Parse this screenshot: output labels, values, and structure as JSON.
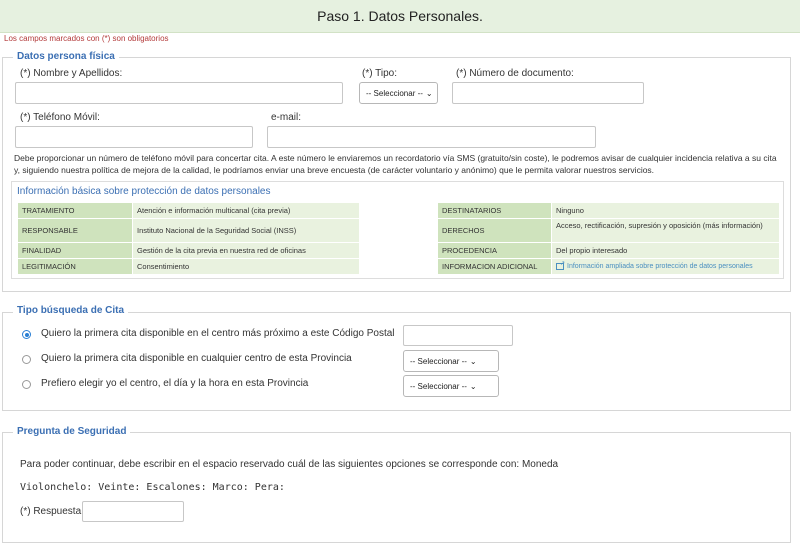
{
  "header": {
    "title": "Paso 1. Datos Personales."
  },
  "required_note": "Los campos marcados con (*) son obligatorios",
  "personal": {
    "legend": "Datos persona física",
    "name_label": "(*) Nombre y Apellidos:",
    "type_label": "(*) Tipo:",
    "type_value": "-- Seleccionar --",
    "doc_label": "(*) Número de documento:",
    "phone_label": "(*) Teléfono Móvil:",
    "email_label": "e-mail:",
    "info_text": "Debe proporcionar un número de teléfono móvil para concertar cita. A este número le enviaremos un recordatorio vía SMS (gratuito/sin coste), le podremos avisar de cualquier incidencia relativa a su cita y, siguiendo nuestra política de mejora de la calidad, le podríamos enviar una breve encuesta (de carácter voluntario y anónimo) que le permita valorar nuestros servicios."
  },
  "data_protection": {
    "title": "Información básica sobre protección de datos personales",
    "left": [
      {
        "key": "TRATAMIENTO",
        "value": "Atención e información multicanal (cita previa)"
      },
      {
        "key": "RESPONSABLE",
        "value": "Instituto Nacional de la Seguridad Social (INSS)"
      },
      {
        "key": "FINALIDAD",
        "value": "Gestión de la cita previa en nuestra red de oficinas"
      },
      {
        "key": "LEGITIMACIÓN",
        "value": "Consentimiento"
      }
    ],
    "right": [
      {
        "key": "DESTINATARIOS",
        "value": "Ninguno"
      },
      {
        "key": "DERECHOS",
        "value": "Acceso, rectificación, supresión y oposición (más información)"
      },
      {
        "key": "PROCEDENCIA",
        "value": "Del propio interesado"
      },
      {
        "key": "INFORMACION ADICIONAL",
        "value": "Información ampliada sobre protección de datos personales"
      }
    ]
  },
  "search": {
    "legend": "Tipo búsqueda de Cita",
    "options": [
      {
        "label": "Quiero la primera cita disponible en el centro más próximo a este Código Postal",
        "selected": true
      },
      {
        "label": "Quiero la primera cita disponible en cualquier centro de esta Provincia",
        "selected": false,
        "select_value": "-- Seleccionar --"
      },
      {
        "label": "Prefiero elegir yo el centro, el día y la hora en esta Provincia",
        "selected": false,
        "select_value": "-- Seleccionar --"
      }
    ]
  },
  "security": {
    "legend": "Pregunta de Seguridad",
    "instruction": "Para poder continuar, debe escribir en el espacio reservado cuál de las siguientes opciones se corresponde con: Moneda",
    "options_text": "Violonchelo: Veinte: Escalones: Marco: Pera:",
    "answer_label": "(*) Respuesta:"
  },
  "colors": {
    "banner": "#e6f1e0",
    "legend": "#3b6fb3",
    "table_key": "#cfe3bd",
    "table_value": "#e9f2df",
    "link": "#4a8fc0",
    "required_note": "#b33a3a"
  }
}
